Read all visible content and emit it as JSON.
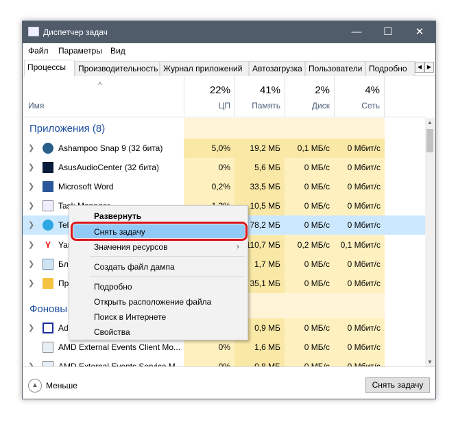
{
  "window": {
    "title": "Диспетчер задач",
    "minimize": "—",
    "maximize": "☐",
    "close": "✕"
  },
  "menu": [
    "Файл",
    "Параметры",
    "Вид"
  ],
  "tabs": [
    "Процессы",
    "Производительность",
    "Журнал приложений",
    "Автозагрузка",
    "Пользователи",
    "Подробно"
  ],
  "header": {
    "sort_arrow": "^",
    "name": "Имя",
    "cpu": {
      "pct": "22%",
      "label": "ЦП"
    },
    "mem": {
      "pct": "41%",
      "label": "Память"
    },
    "disk": {
      "pct": "2%",
      "label": "Диск"
    },
    "net": {
      "pct": "4%",
      "label": "Сеть"
    }
  },
  "groups": {
    "apps": "Приложения (8)",
    "background": "Фоновы"
  },
  "rows": [
    {
      "name": "Ashampoo Snap 9 (32 бита)",
      "cpu": "5,0%",
      "mem": "19,2 МБ",
      "disk": "0,1 МБ/с",
      "net": "0 Мбит/с",
      "icon": "ashampoo-icon"
    },
    {
      "name": "AsusAudioCenter (32 бита)",
      "cpu": "0%",
      "mem": "5,6 МБ",
      "disk": "0 МБ/с",
      "net": "0 Мбит/с",
      "icon": "asus-audio-icon"
    },
    {
      "name": "Microsoft Word",
      "cpu": "0,2%",
      "mem": "33,5 МБ",
      "disk": "0 МБ/с",
      "net": "0 Мбит/с",
      "icon": "word-icon"
    },
    {
      "name": "Task Manager",
      "cpu": "1,3%",
      "mem": "10,5 МБ",
      "disk": "0 МБ/с",
      "net": "0 Мбит/с",
      "icon": "task-manager-icon"
    },
    {
      "name": "Tel",
      "cpu": "",
      "mem": "78,2 МБ",
      "disk": "0 МБ/с",
      "net": "0 Мбит/с",
      "icon": "telegram-icon"
    },
    {
      "name": "Yar",
      "cpu": "",
      "mem": "110,7 МБ",
      "disk": "0,2 МБ/с",
      "net": "0,1 Мбит/с",
      "icon": "yandex-icon"
    },
    {
      "name": "Бло",
      "cpu": "",
      "mem": "1,7 МБ",
      "disk": "0 МБ/с",
      "net": "0 Мбит/с",
      "icon": "notepad-icon"
    },
    {
      "name": "Пр",
      "cpu": "",
      "mem": "35,1 МБ",
      "disk": "0 МБ/с",
      "net": "0 Мбит/с",
      "icon": "explorer-icon"
    },
    {
      "name": "Ado",
      "cpu": "",
      "mem": "0,9 МБ",
      "disk": "0 МБ/с",
      "net": "0 Мбит/с",
      "icon": "window-icon"
    },
    {
      "name": "AMD External Events Client Mo...",
      "cpu": "0%",
      "mem": "1,6 МБ",
      "disk": "0 МБ/с",
      "net": "0 Мбит/с",
      "icon": "service-icon"
    },
    {
      "name": "AMD External Events Service M...",
      "cpu": "0%",
      "mem": "0,8 МБ",
      "disk": "0 МБ/с",
      "net": "0 Мбит/с",
      "icon": "service-icon"
    }
  ],
  "context_menu": {
    "expand": "Развернуть",
    "end_task": "Снять задачу",
    "resource_values": "Значения ресурсов",
    "dump": "Создать файл дампа",
    "details": "Подробно",
    "open_location": "Открыть расположение файла",
    "search_web": "Поиск в Интернете",
    "properties": "Свойства"
  },
  "footer": {
    "less": "Меньше",
    "end_task": "Снять задачу"
  },
  "colors": {
    "titlebar": "#515c6b",
    "selection": "#cce8ff",
    "highlight": "#91c9f7",
    "callout": "#d9161d",
    "group": "#1e4fa0"
  }
}
